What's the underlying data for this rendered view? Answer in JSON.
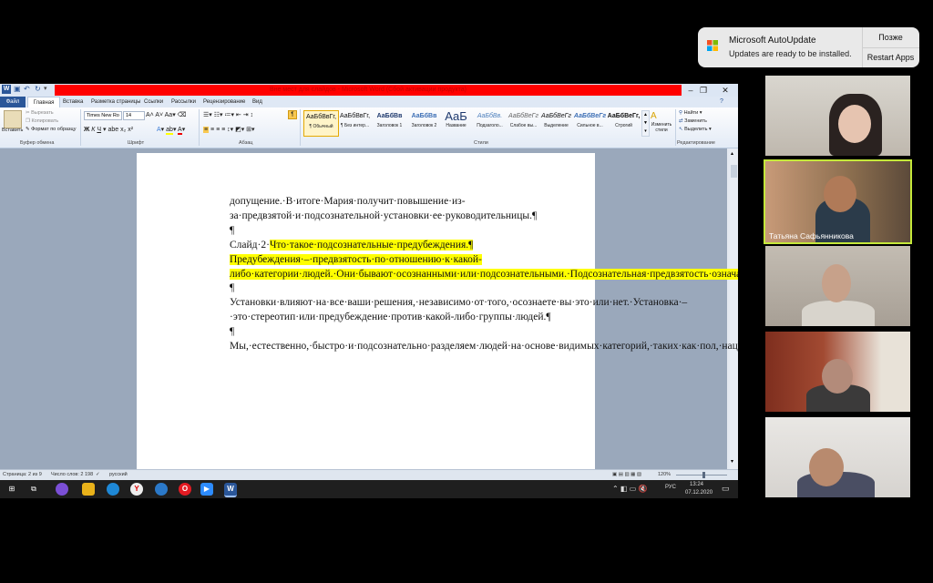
{
  "notification": {
    "title": "Microsoft AutoUpdate",
    "message": "Updates are ready to be installed.",
    "later_label": "Позже",
    "restart_label": "Restart Apps",
    "icon": "microsoft-logo-icon"
  },
  "word": {
    "title": "Вне мест для слайдов - Microsoft Word (Сбой активации продукта)",
    "tabs": [
      "Файл",
      "Главная",
      "Вставка",
      "Разметка страницы",
      "Ссылки",
      "Рассылки",
      "Рецензирование",
      "Вид"
    ],
    "clipboard": {
      "paste": "Вставить",
      "cut": "Вырезать",
      "copy": "Копировать",
      "format_painter": "Формат по образцу",
      "group": "Буфер обмена"
    },
    "font": {
      "name": "Times New Ro",
      "size": "14",
      "group": "Шрифт"
    },
    "paragraph_group": "Абзац",
    "styles": [
      {
        "preview": "АаБбВвГг,",
        "name": "¶ Обычный"
      },
      {
        "preview": "АаБбВвГг,",
        "name": "¶ Без интер..."
      },
      {
        "preview": "АаБбВв",
        "name": "Заголовок 1"
      },
      {
        "preview": "АаБбВв",
        "name": "Заголовок 2"
      },
      {
        "preview": "АаБ",
        "name": "Название"
      },
      {
        "preview": "АаБбВв.",
        "name": "Подзаголо..."
      },
      {
        "preview": "АаБбВеГг",
        "name": "Слабое вы..."
      },
      {
        "preview": "АаБбВеГг",
        "name": "Выделение"
      },
      {
        "preview": "АаБбВеГг",
        "name": "Сильное в..."
      },
      {
        "preview": "АаБбВеГг,",
        "name": "Строгий"
      }
    ],
    "styles_group": "Стили",
    "change_styles": "Изменить стили",
    "editing": {
      "find": "Найти",
      "replace": "Заменить",
      "select": "Выделить",
      "group": "Редактирование"
    },
    "document": {
      "p1": "допущение.·В·итоге·Мария·получит·повышение·из-за·предвзятой·и·подсознательной·установки·ее·руководительницы.¶",
      "pilcrow": "¶",
      "slide_prefix": "Слайд·2·",
      "slide_heading": "Что·такое·подсознательные·предубеждения.¶",
      "p2": "Предубеждения·–·предвзятость·по·отношению·к·какой-либо·категории·людей.·Они·бывают·осознанными·или·подсознательными.·Подсознательная·предвзятость·означает,·что·вы·не·понимаете,·что·вы·предвзяты.·Предвзятость·не·делает·вас·плохим·человеком.·У·всех·нас·есть·предубеждения.·Но·мы·часто·можем·делать·неправильные·выводы·и·предпринимать·действия,·основанные·на·них.·Чтобы·избежать·этого,·необходимо·осознавать·влияние·предвзятости.¶",
      "p3": "Установки·влияют·на·все·ваши·решения,·независимо·от·того,·осознаете·вы·это·или·нет.·Установка·–·это·стереотип·или·предубеждение·против·какой-либо·группы·людей.¶",
      "p4": "Мы,·естественно,·быстро·и·подсознательно·разделяем·людей·на·основе·видимых·категорий,·таких·как·пол,·национальность,·возраст·или·наличие·инвалидности.·Мы·также·понимаем·невидимые·различия·"
    },
    "status": {
      "page": "Страница: 2 из 9",
      "words": "Число слов: 2 198",
      "lang": "русский",
      "zoom": "120%"
    }
  },
  "taskbar": {
    "lang": "РУС",
    "time": "13:24",
    "date": "07.12.2020"
  },
  "participants": [
    {
      "name": ""
    },
    {
      "name": "Татьяна Сафьянникова",
      "active": true
    },
    {
      "name": ""
    },
    {
      "name": ""
    },
    {
      "name": ""
    }
  ],
  "colors": {
    "highlight": "#ffff00",
    "active_speaker": "#c5e83a",
    "title_bar": "#ff0000",
    "word_blue": "#2a5699"
  }
}
